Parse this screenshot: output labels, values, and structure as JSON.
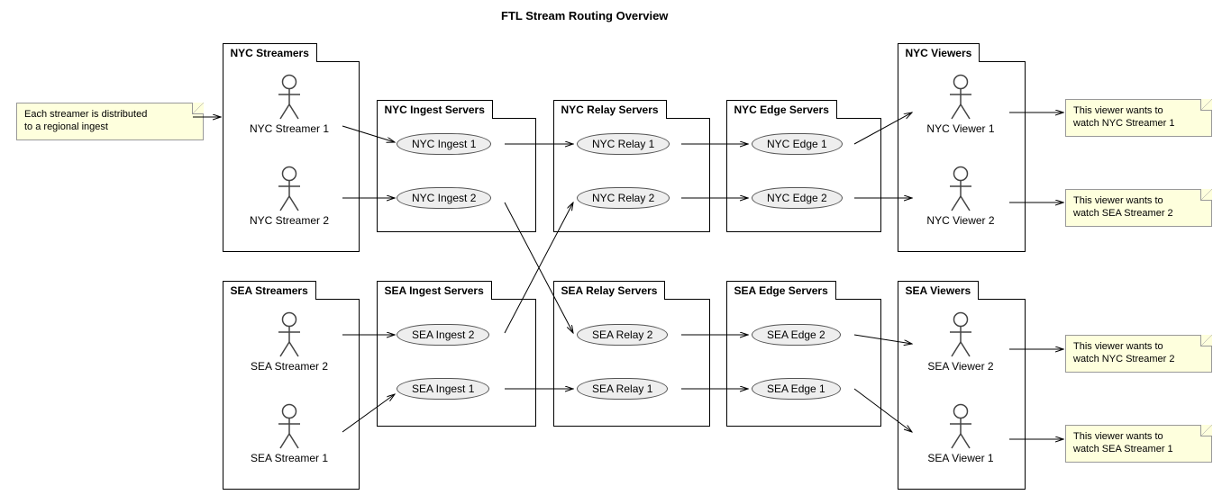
{
  "title": "FTL Stream Routing Overview",
  "packages": {
    "nyc_streamers": "NYC Streamers",
    "nyc_ingest": "NYC Ingest Servers",
    "nyc_relay": "NYC Relay Servers",
    "nyc_edge": "NYC Edge Servers",
    "nyc_viewers": "NYC Viewers",
    "sea_streamers": "SEA Streamers",
    "sea_ingest": "SEA Ingest Servers",
    "sea_relay": "SEA Relay Servers",
    "sea_edge": "SEA Edge Servers",
    "sea_viewers": "SEA Viewers"
  },
  "actors": {
    "nyc_streamer_1": "NYC Streamer 1",
    "nyc_streamer_2": "NYC Streamer 2",
    "sea_streamer_2": "SEA Streamer 2",
    "sea_streamer_1": "SEA Streamer 1",
    "nyc_viewer_1": "NYC Viewer 1",
    "nyc_viewer_2": "NYC Viewer 2",
    "sea_viewer_2": "SEA Viewer 2",
    "sea_viewer_1": "SEA Viewer 1"
  },
  "nodes": {
    "nyc_ingest_1": "NYC Ingest 1",
    "nyc_ingest_2": "NYC Ingest 2",
    "nyc_relay_1": "NYC Relay 1",
    "nyc_relay_2": "NYC Relay 2",
    "nyc_edge_1": "NYC Edge 1",
    "nyc_edge_2": "NYC Edge 2",
    "sea_ingest_2": "SEA Ingest 2",
    "sea_ingest_1": "SEA Ingest 1",
    "sea_relay_2": "SEA Relay 2",
    "sea_relay_1": "SEA Relay 1",
    "sea_edge_2": "SEA Edge 2",
    "sea_edge_1": "SEA Edge 1"
  },
  "notes": {
    "streamers_note": "Each streamer is distributed\nto a regional ingest",
    "nyc_viewer1_note": "This viewer wants to\nwatch NYC Streamer 1",
    "nyc_viewer2_note": "This viewer wants to\nwatch SEA Streamer 2",
    "sea_viewer2_note": "This viewer wants to\nwatch NYC Streamer 2",
    "sea_viewer1_note": "This viewer wants to\nwatch SEA Streamer 1"
  }
}
